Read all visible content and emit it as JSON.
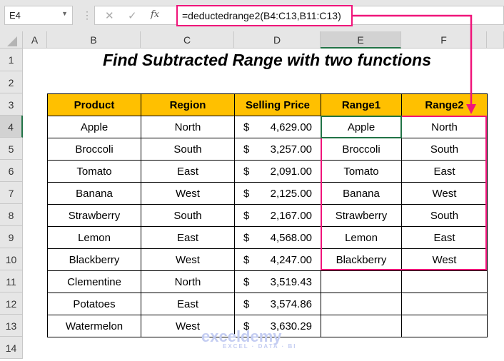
{
  "formula_bar": {
    "name_box": "E4",
    "formula": "=deductedrange2(B4:C13,B11:C13)",
    "cancel": "✕",
    "enter": "✓",
    "fx": "fx"
  },
  "columns": [
    "A",
    "B",
    "C",
    "D",
    "E",
    "F"
  ],
  "rows": [
    "1",
    "2",
    "3",
    "4",
    "5",
    "6",
    "7",
    "8",
    "9",
    "10",
    "11",
    "12",
    "13",
    "14"
  ],
  "title": "Find Subtracted Range with two functions",
  "headers": [
    "Product",
    "Region",
    "Selling Price",
    "Range1",
    "Range2"
  ],
  "data": [
    [
      "Apple",
      "North",
      "$",
      "4,629.00",
      "Apple",
      "North"
    ],
    [
      "Broccoli",
      "South",
      "$",
      "3,257.00",
      "Broccoli",
      "South"
    ],
    [
      "Tomato",
      "East",
      "$",
      "2,091.00",
      "Tomato",
      "East"
    ],
    [
      "Banana",
      "West",
      "$",
      "2,125.00",
      "Banana",
      "West"
    ],
    [
      "Strawberry",
      "South",
      "$",
      "2,167.00",
      "Strawberry",
      "South"
    ],
    [
      "Lemon",
      "East",
      "$",
      "4,568.00",
      "Lemon",
      "East"
    ],
    [
      "Blackberry",
      "West",
      "$",
      "4,247.00",
      "Blackberry",
      "West"
    ],
    [
      "Clementine",
      "North",
      "$",
      "3,519.43",
      "",
      ""
    ],
    [
      "Potatoes",
      "East",
      "$",
      "3,574.86",
      "",
      ""
    ],
    [
      "Watermelon",
      "West",
      "$",
      "3,630.29",
      "",
      ""
    ]
  ],
  "watermark": {
    "name": "exceldemy",
    "tagline": "EXCEL · DATA · BI"
  },
  "colors": {
    "highlight": "#f0147a",
    "header": "#ffc000",
    "selection": "#217346"
  }
}
